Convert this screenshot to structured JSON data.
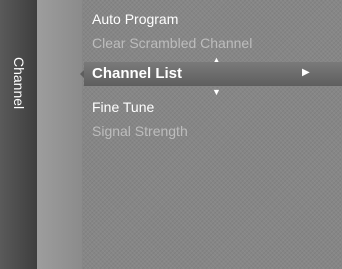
{
  "sidebar": {
    "title": "Channel"
  },
  "icons": [
    {
      "name": "picture-icon"
    },
    {
      "name": "channel-icon"
    },
    {
      "name": "setup-icon"
    },
    {
      "name": "input-icon"
    },
    {
      "name": "support-icon"
    }
  ],
  "menu": {
    "items": [
      {
        "label": "Auto Program",
        "state": "enabled"
      },
      {
        "label": "Clear Scrambled Channel",
        "state": "disabled"
      },
      {
        "label": "Channel List",
        "state": "selected"
      },
      {
        "label": "Fine Tune",
        "state": "enabled"
      },
      {
        "label": "Signal Strength",
        "state": "disabled"
      }
    ],
    "scroll_up": "▲",
    "scroll_down": "▼",
    "submenu_arrow": "▶"
  }
}
